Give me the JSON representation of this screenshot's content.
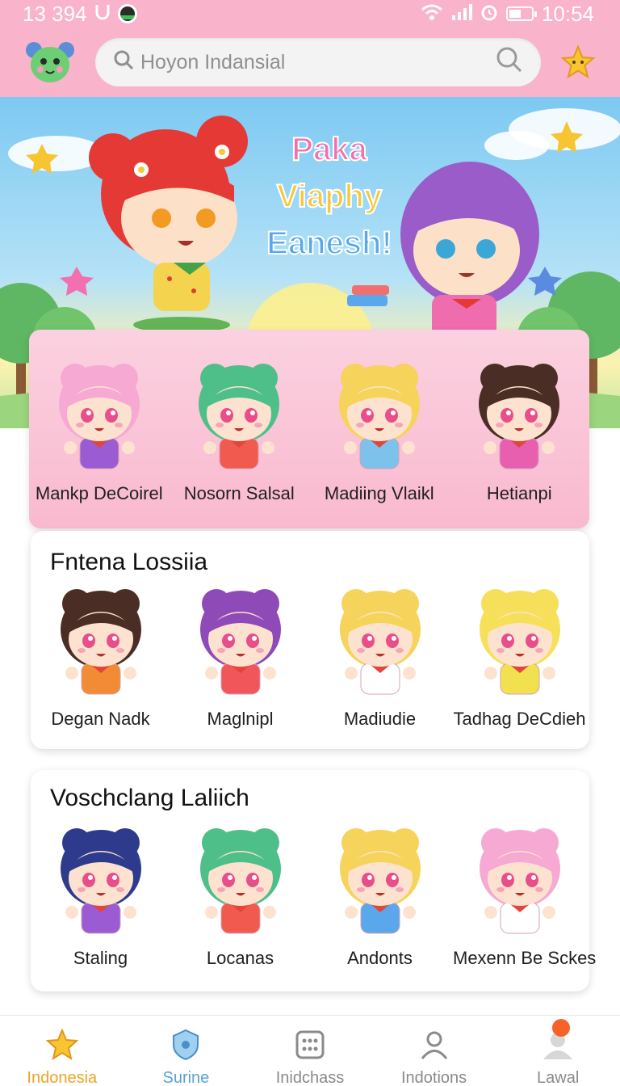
{
  "status_bar": {
    "left_text": "13 394",
    "time": "10:54"
  },
  "search": {
    "placeholder": "Hoyon Indansial"
  },
  "hero": {
    "title_line1": "Paka",
    "title_line2": "Viaphy",
    "title_line3": "Eanesh!"
  },
  "featured": {
    "items": [
      {
        "name": "Mankp DeCoirel",
        "hair": "#f6a9d2",
        "shirt": "#9b5bd3"
      },
      {
        "name": "Nosorn Salsal",
        "hair": "#4fbf8a",
        "shirt": "#f05a4f"
      },
      {
        "name": "Madiing Vlaikl",
        "hair": "#f6d35a",
        "shirt": "#7cc2ea"
      },
      {
        "name": "Hetianpi",
        "hair": "#4a2e25",
        "shirt": "#e85fb0"
      }
    ]
  },
  "section1": {
    "title": "Fntena Lossiia",
    "items": [
      {
        "name": "Degan Nadk",
        "hair": "#4a2e25",
        "shirt": "#f28c34"
      },
      {
        "name": "Maglnipl",
        "hair": "#8e4bb8",
        "shirt": "#f0565a"
      },
      {
        "name": "Madiudie",
        "hair": "#f6d35a",
        "shirt": "#ffffff"
      },
      {
        "name": "Tadhag DeCdieh",
        "hair": "#f6e05a",
        "shirt": "#f2e14f"
      }
    ]
  },
  "section2": {
    "title": "Voschclang Laliich",
    "items": [
      {
        "name": "Staling",
        "hair": "#2e3a8c",
        "shirt": "#9b5bd3"
      },
      {
        "name": "Locanas",
        "hair": "#4fbf8a",
        "shirt": "#f05a4f"
      },
      {
        "name": "Andonts",
        "hair": "#f6d35a",
        "shirt": "#5aa7ec"
      },
      {
        "name": "Mexenn Be Sckes",
        "hair": "#f6a9d2",
        "shirt": "#ffffff"
      }
    ]
  },
  "nav": {
    "items": [
      {
        "label": "Indonesia"
      },
      {
        "label": "Surine"
      },
      {
        "label": "Inidchass"
      },
      {
        "label": "Indotions"
      },
      {
        "label": "Lawal"
      }
    ]
  },
  "colors": {
    "header_pink": "#f9b3cb",
    "active_nav": "#f0a423",
    "accent_blue": "#5aa2d6"
  }
}
